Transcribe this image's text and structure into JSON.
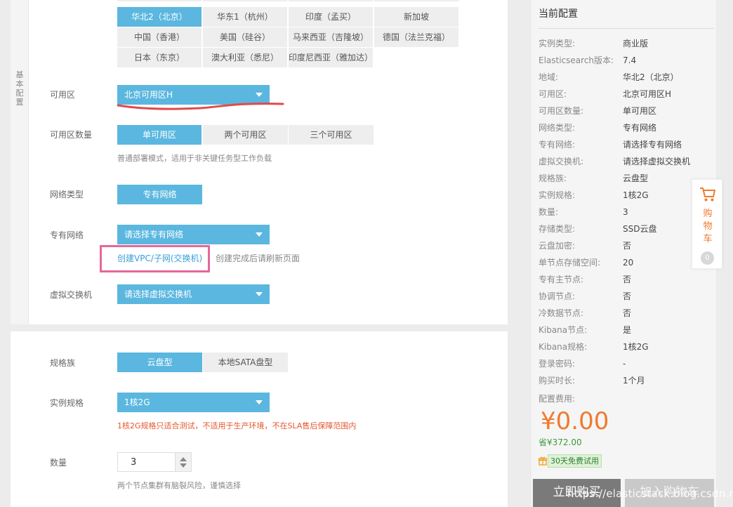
{
  "basic_section": {
    "tab_label_chars": [
      "基",
      "本",
      "配",
      "置"
    ]
  },
  "region": {
    "top_row_partial": [
      "",
      "",
      "",
      ""
    ],
    "rows": [
      [
        "华北2（北京）",
        "华东1（杭州）",
        "印度（孟买）",
        "新加坡"
      ],
      [
        "中国（香港）",
        "美国（硅谷）",
        "马来西亚（吉隆坡）",
        "德国（法兰克福）"
      ],
      [
        "日本（东京）",
        "澳大利亚（悉尼）",
        "印度尼西亚（雅加达）"
      ]
    ]
  },
  "zone": {
    "label": "可用区",
    "value": "北京可用区H"
  },
  "zone_count": {
    "label": "可用区数量",
    "options": [
      "单可用区",
      "两个可用区",
      "三个可用区"
    ],
    "hint": "普通部署模式，适用于非关键任务型工作负载"
  },
  "network_type": {
    "label": "网络类型",
    "option": "专有网络"
  },
  "vpc": {
    "label": "专有网络",
    "value": "请选择专有网络",
    "create_link": "创建VPC/子网(交换机)",
    "refresh_hint": "创建完成后请刷新页面"
  },
  "vswitch": {
    "label": "虚拟交换机",
    "value": "请选择虚拟交换机"
  },
  "spec_family": {
    "label": "规格族",
    "options": [
      "云盘型",
      "本地SATA盘型"
    ]
  },
  "instance_spec": {
    "label": "实例规格",
    "value": "1核2G",
    "warning": "1核2G规格只适合测试，不适用于生产环境，不在SLA售后保障范围内"
  },
  "quantity": {
    "label": "数量",
    "value": "3",
    "hint": "两个节点集群有脑裂风险，谨慎选择"
  },
  "summary": {
    "title": "当前配置",
    "rows": [
      {
        "key": "实例类型:",
        "value": "商业版"
      },
      {
        "key": "Elasticsearch版本:",
        "value": "7.4"
      },
      {
        "key": "地域:",
        "value": "华北2（北京）"
      },
      {
        "key": "可用区:",
        "value": "北京可用区H"
      },
      {
        "key": "可用区数量:",
        "value": "单可用区"
      },
      {
        "key": "网络类型:",
        "value": "专有网络"
      },
      {
        "key": "专有网络:",
        "value": "请选择专有网络"
      },
      {
        "key": "虚拟交换机:",
        "value": "请选择虚拟交换机"
      },
      {
        "key": "规格族:",
        "value": "云盘型"
      },
      {
        "key": "实例规格:",
        "value": "1核2G"
      },
      {
        "key": "数量:",
        "value": "3"
      },
      {
        "key": "存储类型:",
        "value": "SSD云盘"
      },
      {
        "key": "云盘加密:",
        "value": "否"
      },
      {
        "key": "单节点存储空间:",
        "value": "20"
      },
      {
        "key": "专有主节点:",
        "value": "否"
      },
      {
        "key": "协调节点:",
        "value": "否"
      },
      {
        "key": "冷数据节点:",
        "value": "否"
      },
      {
        "key": "Kibana节点:",
        "value": "是"
      },
      {
        "key": "Kibana规格:",
        "value": "1核2G"
      },
      {
        "key": "登录密码:",
        "value": "-"
      },
      {
        "key": "购买时长:",
        "value": "1个月"
      }
    ],
    "fee_label": "配置费用:",
    "price": "¥0.00",
    "saving": "省¥372.00",
    "trial_badge": "30天免费试用",
    "buy_button": "立即购买",
    "add_cart_button": "加入购物车"
  },
  "cart_float": {
    "chars": [
      "购",
      "物",
      "车"
    ],
    "count": "0"
  },
  "watermark": "https://elasticstack.blog.csdn.net",
  "colors": {
    "accent": "#5bb7df",
    "price": "#f07a2e",
    "warning": "#e4572e",
    "highlight_box": "#e5679b"
  }
}
